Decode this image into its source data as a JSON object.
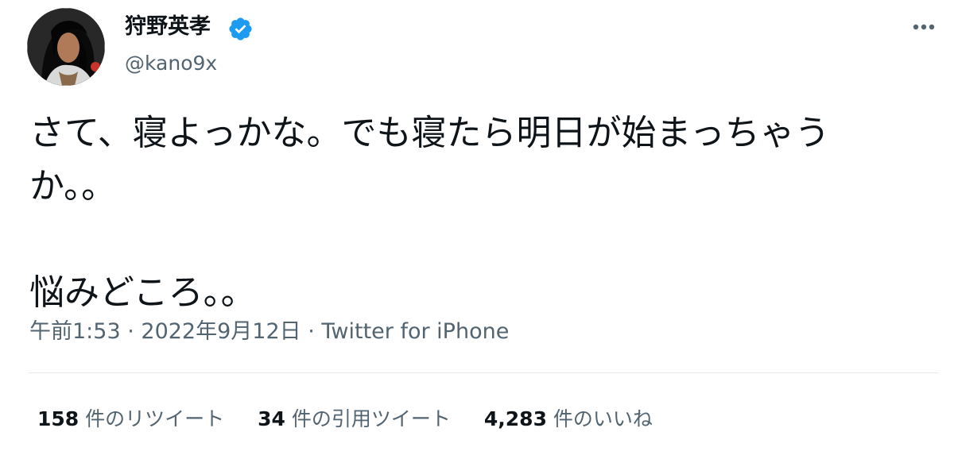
{
  "author": {
    "display_name": "狩野英孝",
    "handle": "@kano9x",
    "verified": true,
    "avatar_icon": "user-avatar-photo",
    "verified_icon": "verified-badge-icon",
    "verified_color": "#1d9bf0"
  },
  "menu": {
    "more_label": "•••",
    "more_icon": "more-options-icon"
  },
  "tweet": {
    "text": "さて、寝よっかな。でも寝たら明日が始まっちゃう\nか。。\n\n悩みどころ。。"
  },
  "meta": {
    "time": "午前1:53",
    "sep1": " · ",
    "date": "2022年9月12日",
    "sep2": " · ",
    "source": "Twitter for iPhone"
  },
  "stats": {
    "retweets_count": "158",
    "retweets_label": " 件のリツイート",
    "quotes_count": "34",
    "quotes_label": " 件の引用ツイート",
    "likes_count": "4,283",
    "likes_label": " 件のいいね"
  },
  "colors": {
    "text": "#0f1419",
    "secondary": "#536471",
    "divider": "#e6ecf0"
  }
}
